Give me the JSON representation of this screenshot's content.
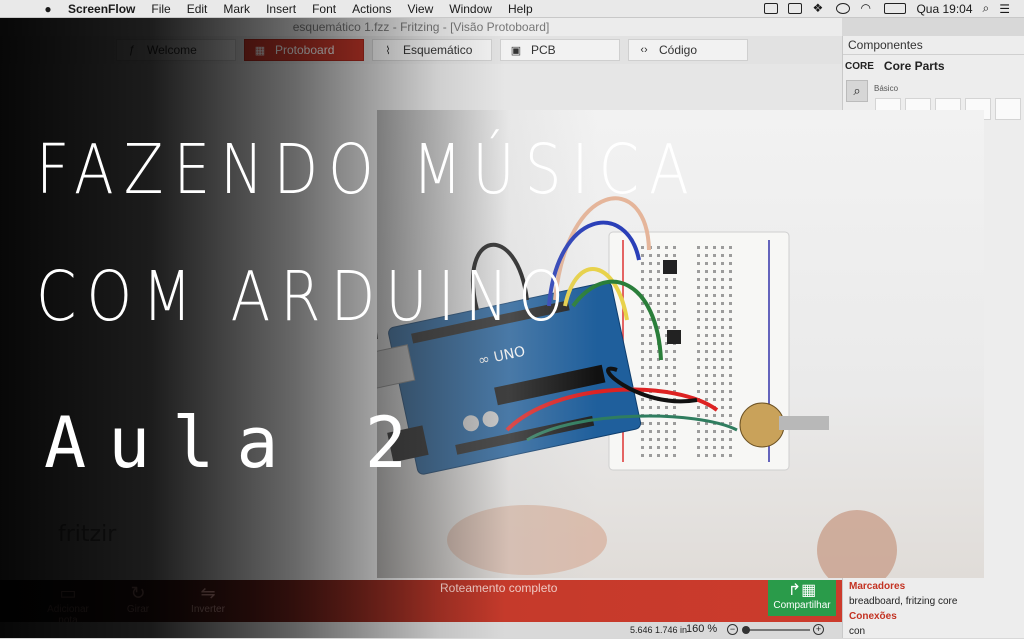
{
  "menubar": {
    "app_name": "ScreenFlow",
    "items": [
      "File",
      "Edit",
      "Mark",
      "Insert",
      "Font",
      "Actions",
      "View",
      "Window",
      "Help"
    ],
    "clock": "Qua 19:04"
  },
  "window": {
    "title": "esquemático 1.fzz - Fritzing - [Visão Protoboard]"
  },
  "tabs": [
    {
      "label": "Welcome",
      "icon": "fritzing-f-icon",
      "active": false
    },
    {
      "label": "Protoboard",
      "icon": "breadboard-icon",
      "active": true
    },
    {
      "label": "Esquemático",
      "icon": "resistor-icon",
      "active": false
    },
    {
      "label": "PCB",
      "icon": "pcb-icon",
      "active": false
    },
    {
      "label": "Código",
      "icon": "code-icon",
      "active": false
    }
  ],
  "components_panel": {
    "title": "Componentes",
    "bin_label": "CORE",
    "bin_title": "Core Parts",
    "section": "Básico",
    "props_heading": "Marcadores",
    "props_value": "breadboard, fritzing core",
    "connections_heading": "Conexões",
    "connections_value": "con"
  },
  "canvas": {
    "logo_text": "fritzir"
  },
  "bottom_toolbar": {
    "buttons": [
      "Adicionar nota",
      "Girar",
      "Inverter"
    ],
    "routing_status": "Roteamento completo",
    "share_label": "Compartilhar"
  },
  "status": {
    "coordinates": "5.646 1.746 in",
    "zoom_value": "160",
    "zoom_unit": "%"
  },
  "overlay": {
    "line1": "FAZENDO MÚSICA",
    "line2": "COM ARDUINO",
    "line3": "Aula 2"
  },
  "colors": {
    "accent_red": "#c9382a",
    "share_green": "#2a9b4a",
    "arduino_blue": "#1f5f9c"
  }
}
